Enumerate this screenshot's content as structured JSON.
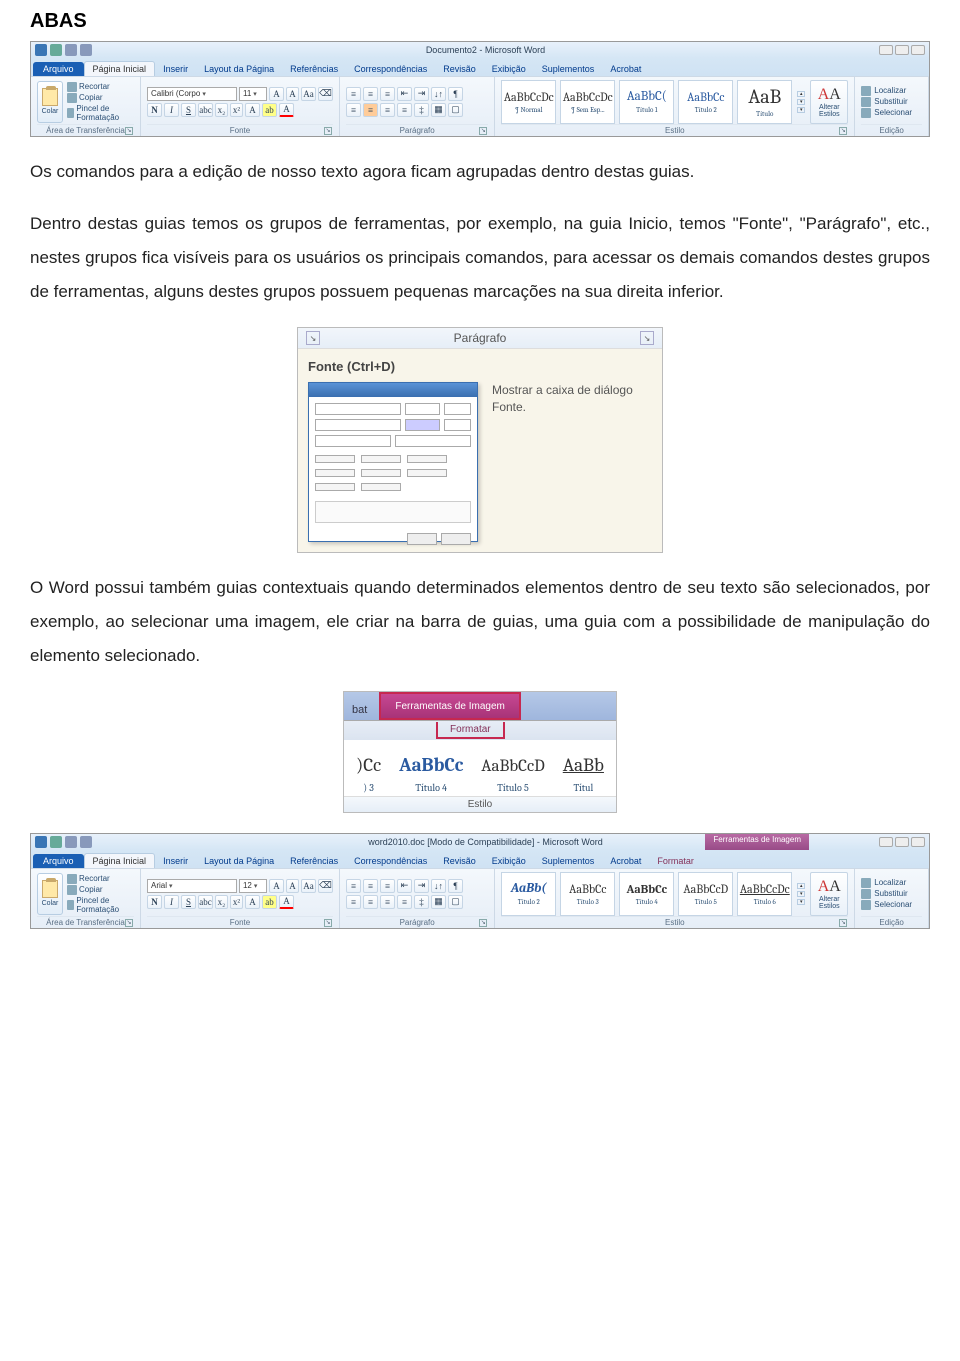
{
  "heading": "ABAS",
  "paragraphs": {
    "p1": "Os comandos para a edição de nosso texto agora ficam agrupadas dentro destas guias.",
    "p2": "Dentro destas guias temos os grupos de ferramentas, por exemplo, na guia Inicio, temos \"Fonte\", \"Parágrafo\", etc., nestes grupos fica visíveis para os usuários os principais comandos, para acessar os demais comandos destes grupos de ferramentas, alguns destes grupos possuem pequenas marcações na sua direita inferior.",
    "p3": "O Word possui também guias contextuais quando determinados elementos dentro de seu texto são selecionados, por exemplo, ao selecionar uma imagem, ele criar na barra de guias, uma guia com a possibilidade de manipulação do elemento selecionado."
  },
  "word1": {
    "title": "Documento2 - Microsoft Word",
    "tabs": [
      "Arquivo",
      "Página Inicial",
      "Inserir",
      "Layout da Página",
      "Referências",
      "Correspondências",
      "Revisão",
      "Exibição",
      "Suplementos",
      "Acrobat"
    ],
    "clipboard": {
      "paste": "Colar",
      "cut": "Recortar",
      "copy": "Copiar",
      "brush": "Pincel de Formatação",
      "label": "Área de Transferência"
    },
    "font": {
      "name": "Calibri (Corpo",
      "size": "11",
      "label": "Fonte"
    },
    "paragraph": {
      "label": "Parágrafo"
    },
    "styles": {
      "items": [
        {
          "preview": "AaBbCcDc",
          "label": "¶ Normal"
        },
        {
          "preview": "AaBbCcDc",
          "label": "¶ Sem Esp..."
        },
        {
          "preview": "AaBbC(",
          "label": "Título 1"
        },
        {
          "preview": "AaBbCc",
          "label": "Título 2"
        },
        {
          "preview": "AaB",
          "label": "Título"
        }
      ],
      "change": "Alterar Estilos",
      "label": "Estilo"
    },
    "editing": {
      "find": "Localizar",
      "replace": "Substituir",
      "select": "Selecionar",
      "label": "Edição"
    }
  },
  "tooltip": {
    "header": "Parágrafo",
    "title": "Fonte (Ctrl+D)",
    "desc": "Mostrar a caixa de diálogo Fonte."
  },
  "ctx": {
    "toolgroup": "Ferramentas de Imagem",
    "bat": "bat",
    "formatar": "Formatar",
    "styles": [
      {
        "p": ")Cc",
        "l": ") 3"
      },
      {
        "p": "AaBbCc",
        "l": "Título 4"
      },
      {
        "p": "AaBbCcD",
        "l": "Título 5"
      },
      {
        "p": "AaBb",
        "l": "Títul",
        "underline": true
      }
    ],
    "footer": "Estilo"
  },
  "word2": {
    "title": "word2010.doc [Modo de Compatibilidade] - Microsoft Word",
    "ctxlabel": "Ferramentas de Imagem",
    "tabs": [
      "Arquivo",
      "Página Inicial",
      "Inserir",
      "Layout da Página",
      "Referências",
      "Correspondências",
      "Revisão",
      "Exibição",
      "Suplementos",
      "Acrobat",
      "Formatar"
    ],
    "clipboard": {
      "paste": "Colar",
      "cut": "Recortar",
      "copy": "Copiar",
      "brush": "Pincel de Formatação",
      "label": "Área de Transferência"
    },
    "font": {
      "name": "Arial",
      "size": "12",
      "label": "Fonte"
    },
    "paragraph": {
      "label": "Parágrafo"
    },
    "styles": {
      "items": [
        {
          "preview": "AaBb(",
          "label": "Título 2"
        },
        {
          "preview": "AaBbCc",
          "label": "Título 3"
        },
        {
          "preview": "AaBbCc",
          "label": "Título 4"
        },
        {
          "preview": "AaBbCcD",
          "label": "Título 5"
        },
        {
          "preview": "AaBbCcDc",
          "label": "Título 6"
        }
      ],
      "change": "Alterar Estilos",
      "label": "Estilo"
    },
    "editing": {
      "find": "Localizar",
      "replace": "Substituir",
      "select": "Selecionar",
      "label": "Edição"
    }
  }
}
